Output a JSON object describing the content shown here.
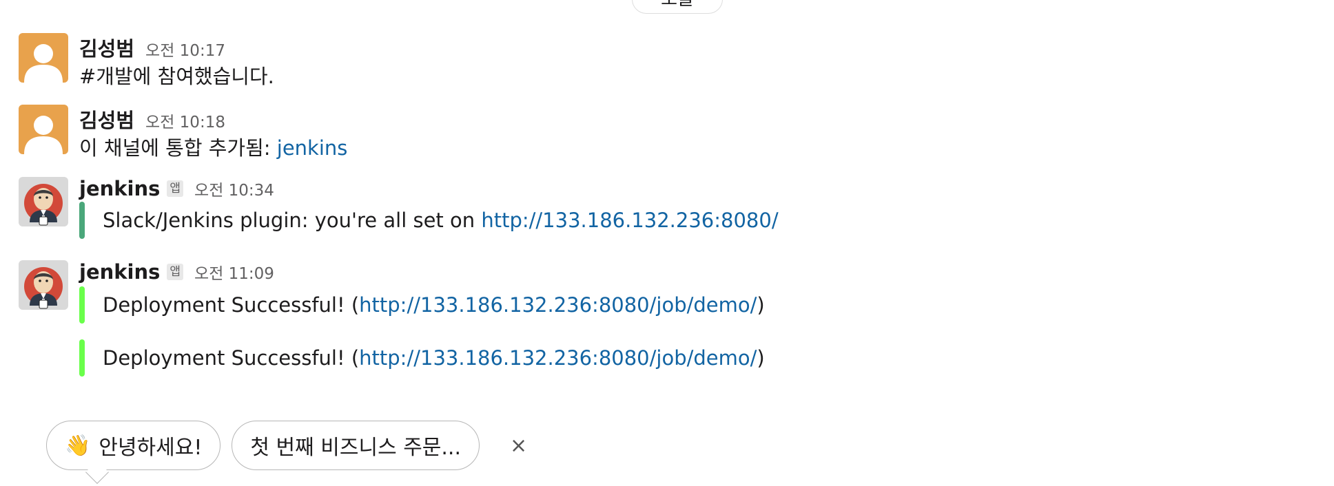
{
  "date_divider": {
    "label": "오늘"
  },
  "messages": [
    {
      "sender": "김성범",
      "time": "오전 10:17",
      "text": "#개발에 참여했습니다."
    },
    {
      "sender": "김성범",
      "time": "오전 10:18",
      "text_prefix": "이 채널에 통합 추가됨: ",
      "link": "jenkins"
    },
    {
      "sender": "jenkins",
      "badge": "앱",
      "time": "오전 10:34",
      "attachment": {
        "text": "Slack/Jenkins plugin: you're all set on ",
        "link": "http://133.186.132.236:8080/",
        "color": "#2eb67d"
      }
    },
    {
      "sender": "jenkins",
      "badge": "앱",
      "time": "오전 11:09",
      "attachments": [
        {
          "prefix": "Deployment Successful! (",
          "link": "http://133.186.132.236:8080/job/demo/",
          "suffix": ")",
          "color": "#6aff4b"
        },
        {
          "prefix": "Deployment Successful! (",
          "link": "http://133.186.132.236:8080/job/demo/",
          "suffix": ")",
          "color": "#6aff4b"
        }
      ]
    }
  ],
  "suggestions": {
    "items": [
      {
        "emoji": "👋",
        "label": "안녕하세요!"
      },
      {
        "label": "첫 번째 비즈니스 주문..."
      }
    ],
    "dismiss": "×"
  }
}
